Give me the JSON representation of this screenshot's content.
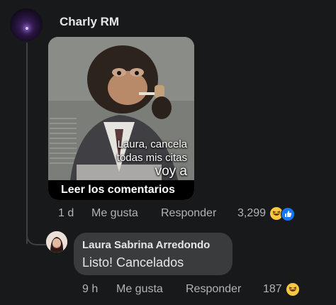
{
  "comment": {
    "author": "Charly RM",
    "meme_text": [
      "Laura, cancela",
      "todas mis citas",
      "voy a"
    ],
    "read_more_label": "Leer los comentarios",
    "time": "1 d",
    "like_label": "Me gusta",
    "reply_label": "Responder",
    "reaction_count": "3,299",
    "reaction_icons": [
      "haha-icon",
      "like-icon"
    ]
  },
  "reply": {
    "author": "Laura Sabrina Arredondo",
    "text": "Listo! Cancelados",
    "time": "9 h",
    "like_label": "Me gusta",
    "reply_label": "Responder",
    "reaction_count": "187",
    "reaction_icons": [
      "haha-icon"
    ]
  },
  "colors": {
    "background": "#18191a",
    "bubble": "#3a3b3c",
    "primary_text": "#e4e6eb",
    "secondary_text": "#b0b3b8",
    "like_blue": "#1877f2",
    "haha_yellow": "#f7c843"
  }
}
